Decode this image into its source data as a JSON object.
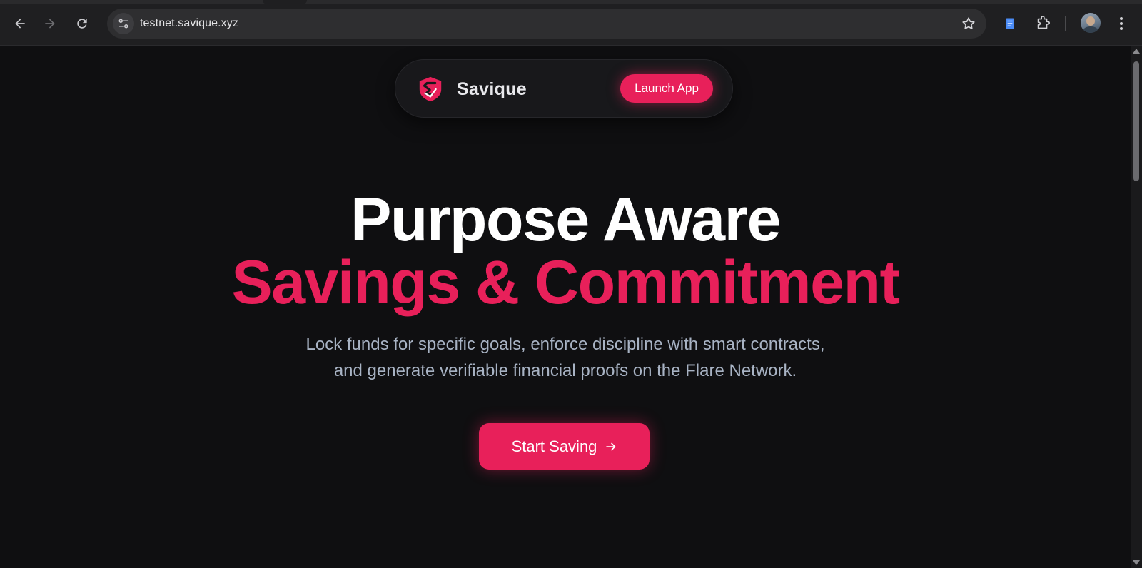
{
  "browser": {
    "url": "testnet.savique.xyz"
  },
  "site": {
    "brand": "Savique",
    "launch_label": "Launch App"
  },
  "hero": {
    "title_line1": "Purpose Aware",
    "title_line2": "Savings & Commitment",
    "subtitle_line1": "Lock funds for specific goals, enforce discipline with smart contracts,",
    "subtitle_line2": "and generate verifiable financial proofs on the Flare Network.",
    "cta_label": "Start Saving"
  },
  "colors": {
    "accent": "#e8205a",
    "background": "#0f0f11",
    "subtitle": "#a8b3c4"
  }
}
